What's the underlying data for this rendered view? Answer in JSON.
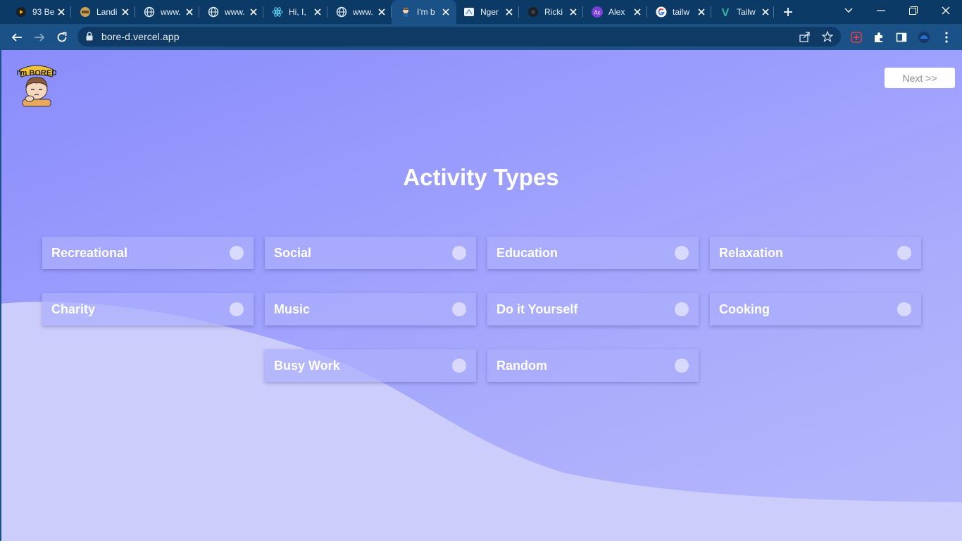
{
  "browser": {
    "tabs": [
      {
        "title": "93 Be",
        "icon": "github-icon"
      },
      {
        "title": "Landi",
        "icon": "landing-icon"
      },
      {
        "title": "www.",
        "icon": "globe-icon"
      },
      {
        "title": "www.",
        "icon": "globe-icon"
      },
      {
        "title": "Hi, I,",
        "icon": "react-icon"
      },
      {
        "title": "www.",
        "icon": "globe-icon"
      },
      {
        "title": "I'm b",
        "icon": "bored-icon",
        "active": true
      },
      {
        "title": "Nger",
        "icon": "ngrok-icon"
      },
      {
        "title": "Ricki",
        "icon": "github-icon"
      },
      {
        "title": "Alex",
        "icon": "ac-icon",
        "badge": "Ac"
      },
      {
        "title": "tailw",
        "icon": "google-icon"
      },
      {
        "title": "Tailw",
        "icon": "vue-icon",
        "badge": "V"
      }
    ],
    "url": "bore-d.vercel.app"
  },
  "page": {
    "logo_text": "I'm BORED",
    "next_label": "Next >>",
    "heading": "Activity Types",
    "options": [
      {
        "label": "Recreational",
        "selected": false
      },
      {
        "label": "Social",
        "selected": false
      },
      {
        "label": "Education",
        "selected": false
      },
      {
        "label": "Relaxation",
        "selected": false
      },
      {
        "label": "Charity",
        "selected": false
      },
      {
        "label": "Music",
        "selected": false
      },
      {
        "label": "Do it Yourself",
        "selected": false
      },
      {
        "label": "Cooking",
        "selected": false
      },
      {
        "label": "Busy Work",
        "selected": false
      },
      {
        "label": "Random",
        "selected": false
      }
    ]
  },
  "colors": {
    "chrome_dark": "#0b3a66",
    "chrome_toolbar": "#1a5288",
    "page_gradient_start": "#8a8cfb",
    "page_gradient_end": "#b6b8fc",
    "wave": "#cdcdfb"
  }
}
